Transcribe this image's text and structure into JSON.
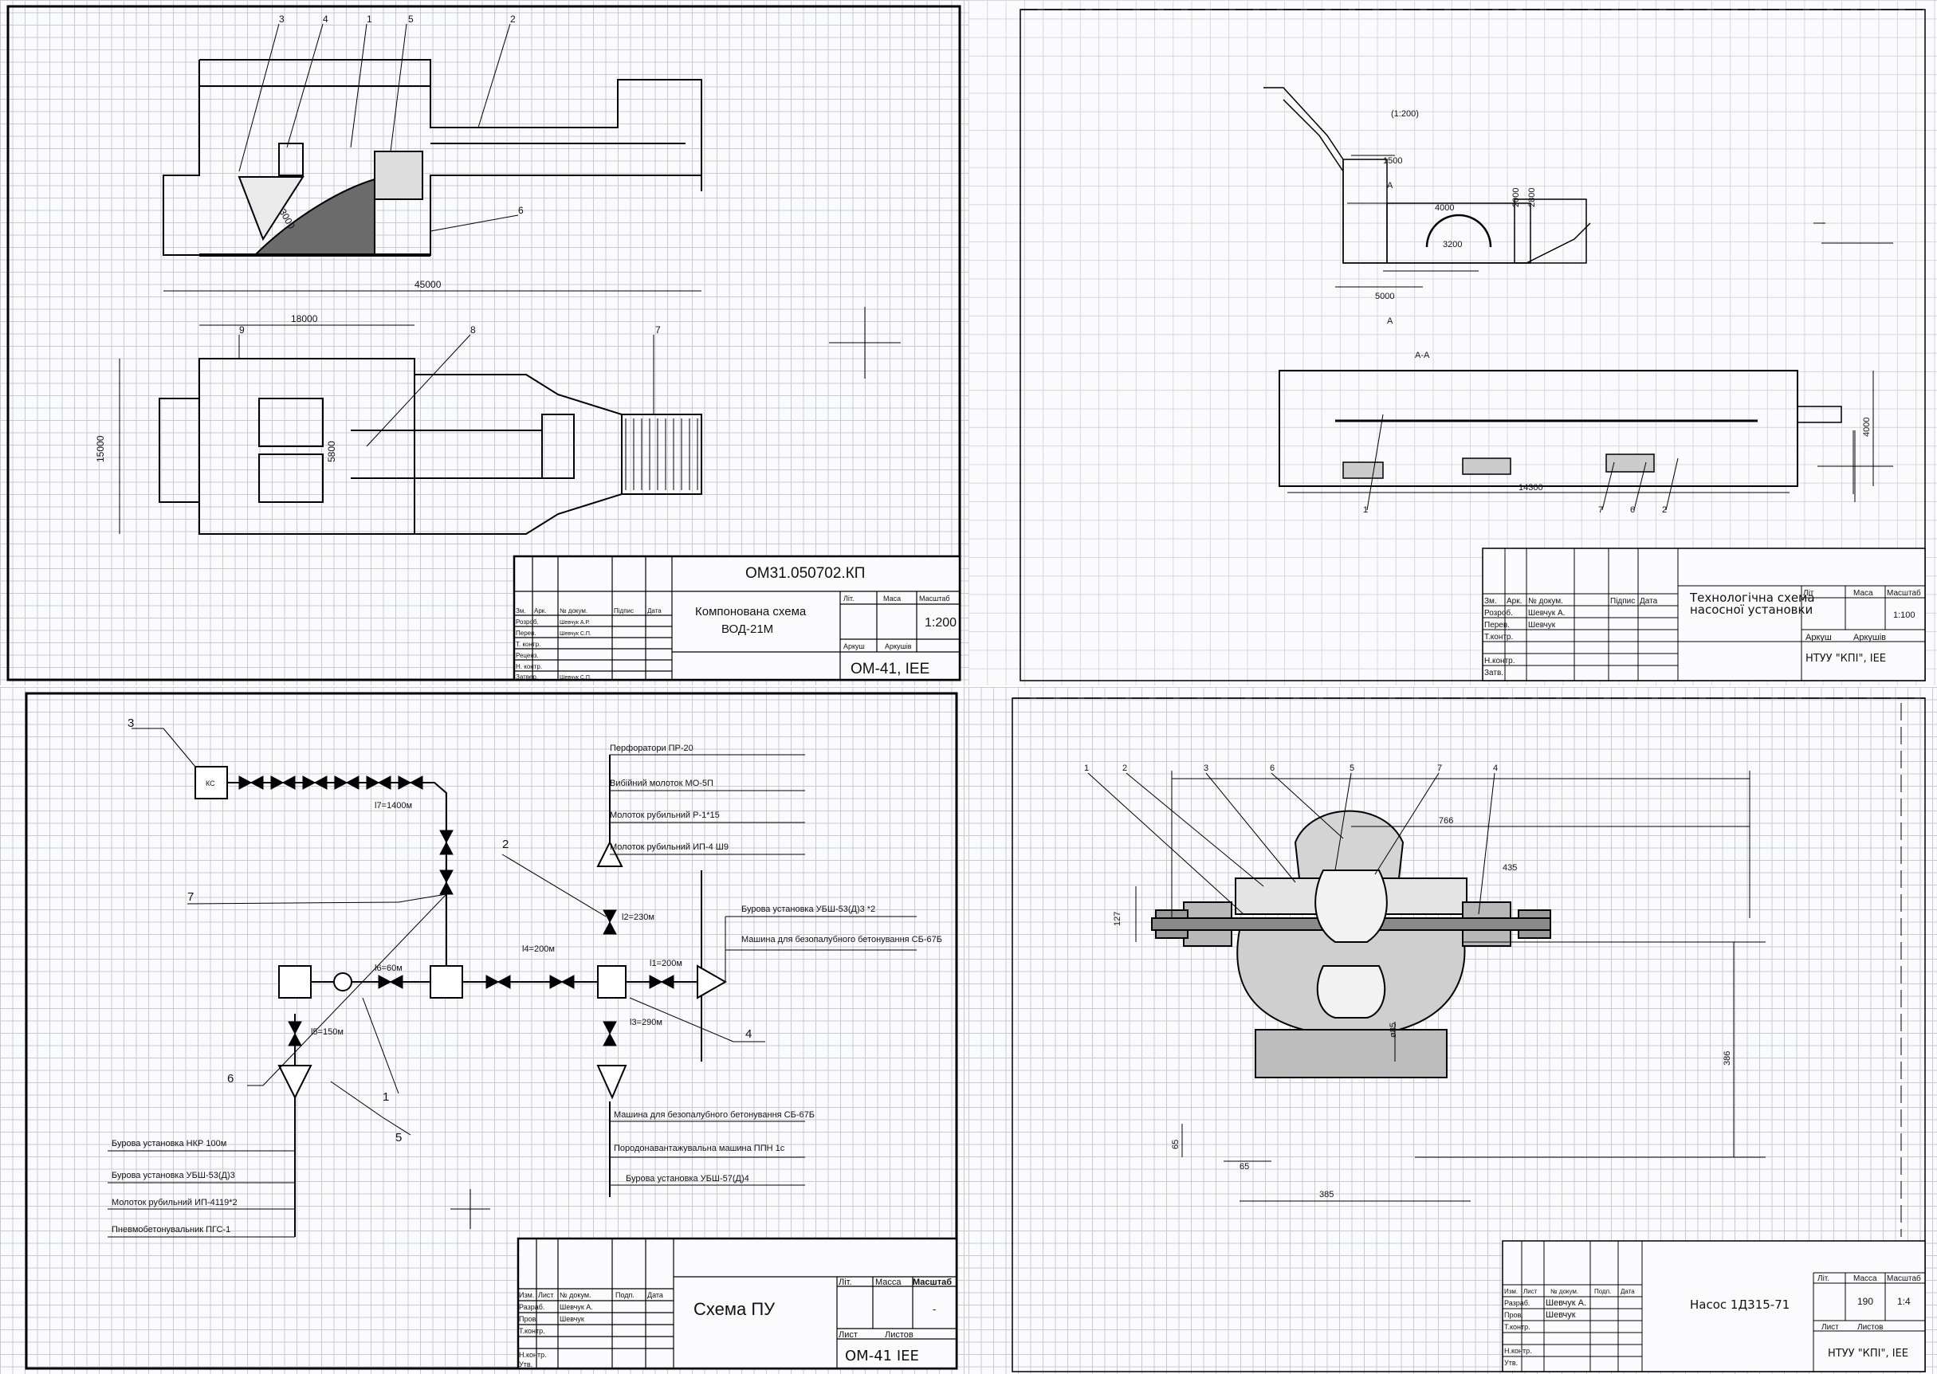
{
  "sheet1": {
    "code": "ОМ31.050702.КП",
    "title_line1": "Компонована схема",
    "title_line2": "ВОД-21М",
    "scale": "1:200",
    "group": "ОМ-41, ІЕЕ",
    "col_lit": "Літ.",
    "col_mass": "Маса",
    "col_scale": "Масштаб",
    "col_sheet": "Аркуш",
    "col_sheets": "Аркушів",
    "hdr_change": "Зм.",
    "hdr_sheet": "Арк.",
    "hdr_doc": "№ докум.",
    "hdr_sign": "Підпис",
    "hdr_date": "Дата",
    "roles": [
      "Розроб.",
      "Перев.",
      "Т. контр.",
      "Реценз.",
      "Н. контр.",
      "Затвер."
    ],
    "dev_name": "Шевчук А.Р.",
    "chk_name": "Шевчук С.П.",
    "appr_name": "Шевчук С.П.",
    "dims": [
      "45000",
      "18000",
      "15000",
      "5800",
      "3000"
    ],
    "labels": [
      "1",
      "2",
      "3",
      "4",
      "5",
      "6",
      "7",
      "8",
      "9"
    ]
  },
  "sheet2": {
    "scale_note": "(1:200)",
    "section_marker": "А",
    "section_title": "А-А",
    "title_line1": "Технологічна схема",
    "title_line2": "насосної установки",
    "scale": "1:100",
    "org": "НТУУ \"КПІ\", ІЕЕ",
    "col_lit": "Літ",
    "col_mass": "Маса",
    "col_scale": "Масштаб",
    "col_sheet": "Аркуш",
    "col_sheets": "Аркушів",
    "hdr": [
      "Зм.",
      "Арк.",
      "№ докум.",
      "Підпис",
      "Дата"
    ],
    "roles": [
      "Розроб.",
      "Перев.",
      "Т.контр.",
      "Н.контр.",
      "Затв."
    ],
    "dev_name": "Шевчук А.",
    "chk_name": "Шевчук",
    "dims": [
      "1500",
      "4000",
      "2000",
      "3200",
      "5000",
      "2800",
      "14300",
      "4000"
    ],
    "labels": [
      "1",
      "2",
      "6",
      "7"
    ]
  },
  "sheet3": {
    "title": "Схема ПУ",
    "group": "ОМ-41  ІЕЕ",
    "col_lit": "Літ.",
    "col_mass": "Масса",
    "col_scale": "Масштаб",
    "col_sheet": "Лист",
    "col_sheets": "Листов",
    "scale": "-",
    "hdr": [
      "Изм.",
      "Лист",
      "№ докум.",
      "Подп.",
      "Дата"
    ],
    "roles": [
      "Разраб.",
      "Пров.",
      "Т.контр.",
      "Н.контр.",
      "Утв."
    ],
    "dev_name": "Шевчук А.",
    "chk_name": "Шевчук",
    "compressor": "КС",
    "pipe_main": "l7=1400м",
    "pipe_l6": "l6=60м",
    "pipe_l5": "l5=150м",
    "pipe_l4": "l4=200м",
    "pipe_l2": "l2=230м",
    "pipe_l3": "l3=290м",
    "pipe_l1": "l1=200м",
    "consumers_top": [
      "Перфоратори ПР-20",
      "Вибійний молоток МО-5П",
      "Молоток рубильний Р-1*15",
      "Молоток рубильний ИП-4 Ш9"
    ],
    "consumers_right": [
      "Бурова установка УБШ-53(Д)3 *2",
      "Машина для безопалубного бетонування СБ-67Б"
    ],
    "consumers_bottom_right": [
      "Машина для безопалубного бетонування СБ-67Б",
      "Породонавантажувальна машина ППН 1с",
      "Бурова установка УБШ-57(Д)4"
    ],
    "consumers_left": [
      "Бурова установка НКР 100м",
      "Бурова установка УБШ-53(Д)3",
      "Молоток рубильний ИП-4119*2",
      "Пневмобетонувальник ПГС-1"
    ],
    "labels": [
      "1",
      "2",
      "3",
      "4",
      "5",
      "6",
      "7"
    ]
  },
  "sheet4": {
    "title": "Насос 1Д315-71",
    "mass": "190",
    "scale": "1:4",
    "org": "НТУУ \"КПІ\", ІЕЕ",
    "col_lit": "Літ.",
    "col_mass": "Масса",
    "col_scale": "Масштаб",
    "col_sheet": "Лист",
    "col_sheets": "Листов",
    "hdr": [
      "Изм.",
      "Лист",
      "№ докум.",
      "Подп.",
      "Дата"
    ],
    "roles": [
      "Разраб.",
      "Пров.",
      "Т.контр.",
      "Н.контр.",
      "Утв."
    ],
    "dev_name": "Шевчук А.",
    "chk_name": "Шевчук",
    "dims": [
      "766",
      "435",
      "127",
      "386",
      "385",
      "65",
      "65",
      "ø85"
    ],
    "labels": [
      "1",
      "2",
      "3",
      "6",
      "5",
      "7",
      "4"
    ]
  }
}
